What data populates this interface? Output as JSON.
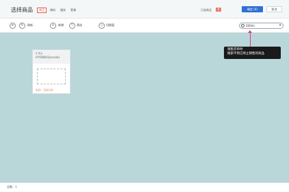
{
  "header": {
    "title": "选择商品",
    "tabs": [
      {
        "label": "商品",
        "active": true
      },
      {
        "label": "物料",
        "active": false
      },
      {
        "label": "服务",
        "active": false
      },
      {
        "label": "套餐",
        "active": false
      }
    ],
    "selected_label": "已选商品",
    "selected_count": "0",
    "confirm_label": "确定 (0)",
    "cancel_label": "取消"
  },
  "toolbar": {
    "menu_icon": "list-icon",
    "refresh_label": "刷新",
    "add_label": "新增",
    "filter_label": "筛选",
    "shortcut_label": "切换窗",
    "search_value": "500ml"
  },
  "tooltip": {
    "line1": "销售开单时",
    "line2": "搜索不到已停止销售的商品"
  },
  "products": [
    {
      "category": "矿泉水",
      "name": "HY088(Qocoda)",
      "price": "¥20 - 200.00"
    }
  ],
  "footer": {
    "total_text": "总数：1"
  },
  "colors": {
    "accent": "#2f6fd6",
    "danger": "#e25b4b",
    "background": "#b9d6d9",
    "tooltip": "#1a1a1a",
    "arrow": "#d23c8a"
  }
}
